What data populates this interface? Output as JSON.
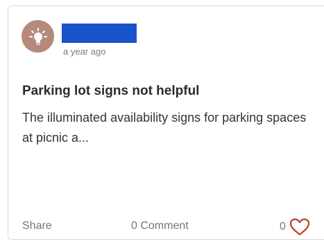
{
  "post": {
    "avatar_icon": "lightbulb-icon",
    "avatar_color": "#b58a7b",
    "author_redaction_color": "#1a52c9",
    "timestamp": "a year ago",
    "title": "Parking lot signs not helpful",
    "excerpt": "The illuminated availability signs for parking spaces at picnic a..."
  },
  "footer": {
    "share_label": "Share",
    "comment_label": "0 Comment",
    "like_count": "0",
    "like_icon": "heart-outline-icon",
    "like_color": "#c0392b"
  }
}
